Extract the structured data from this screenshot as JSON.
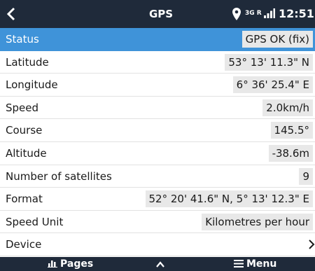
{
  "header": {
    "back_icon": "chevron-left-icon",
    "title": "GPS",
    "location_icon": "map-pin-icon",
    "network": "3G R",
    "signal_icon": "signal-bars-icon",
    "time": "12:51"
  },
  "rows": [
    {
      "label": "Status",
      "value": "GPS OK (fix)"
    },
    {
      "label": "Latitude",
      "value": "53° 13' 11.3\" N"
    },
    {
      "label": "Longitude",
      "value": "6° 36' 25.4\" E"
    },
    {
      "label": "Speed",
      "value": "2.0km/h"
    },
    {
      "label": "Course",
      "value": "145.5°"
    },
    {
      "label": "Altitude",
      "value": "-38.6m"
    },
    {
      "label": "Number of satellites",
      "value": "9"
    },
    {
      "label": "Format",
      "value": "52° 20' 41.6\" N, 5° 13' 12.3\" E"
    },
    {
      "label": "Speed Unit",
      "value": "Kilometres per hour"
    },
    {
      "label": "Device"
    }
  ],
  "footer": {
    "pages_label": "Pages",
    "pages_icon": "bar-chart-icon",
    "up_icon": "chevron-up-icon",
    "menu_label": "Menu",
    "menu_icon": "hamburger-icon"
  },
  "colors": {
    "header_bg": "#1f2a3a",
    "selected_row": "#3f93d9",
    "value_bg": "#e8e8e8"
  }
}
